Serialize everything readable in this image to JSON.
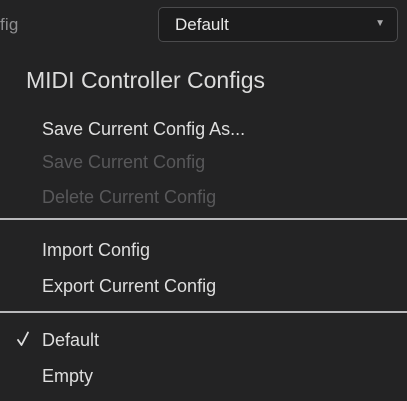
{
  "header": {
    "config_label": "fig",
    "dropdown": {
      "selected": "Default",
      "caret_icon": "chevron-down-icon"
    }
  },
  "menu": {
    "heading": "MIDI Controller Configs",
    "items": [
      {
        "label": "Save Current Config As...",
        "enabled": true
      },
      {
        "label": "Save Current Config",
        "enabled": false
      },
      {
        "label": "Delete Current Config",
        "enabled": false
      },
      {
        "label": "Import Config",
        "enabled": true
      },
      {
        "label": "Export Current Config",
        "enabled": true
      },
      {
        "label": "Default",
        "enabled": true,
        "checked": true
      },
      {
        "label": "Empty",
        "enabled": true,
        "checked": false
      }
    ]
  },
  "colors": {
    "background": "#232324",
    "text": "#dedede",
    "disabled_text": "#58585a",
    "divider": "#b9b9bb"
  }
}
